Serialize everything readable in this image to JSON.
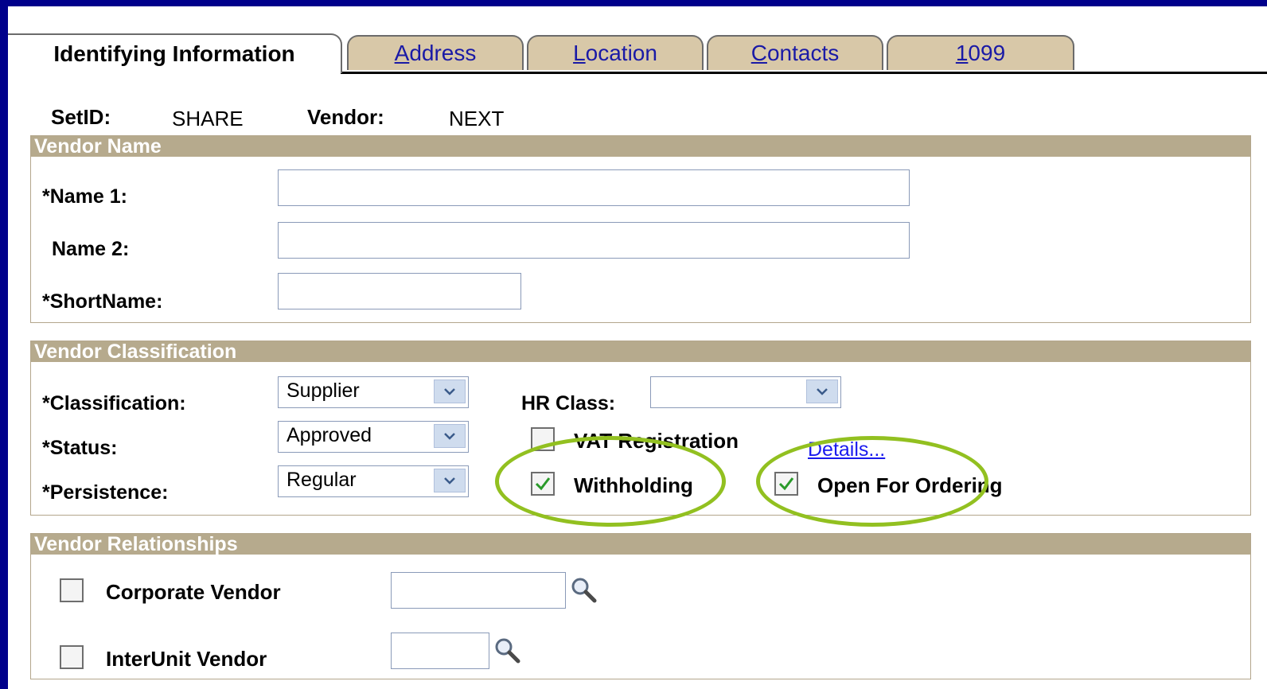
{
  "tabs": [
    {
      "label": "Identifying Information",
      "active": true
    },
    {
      "label": "Address",
      "active": false,
      "underline_char": "A"
    },
    {
      "label": "Location",
      "active": false,
      "underline_char": "L"
    },
    {
      "label": "Contacts",
      "active": false,
      "underline_char": "C"
    },
    {
      "label": "1099",
      "active": false,
      "underline_char": "1"
    }
  ],
  "header": {
    "setid_label": "SetID:",
    "setid_value": "SHARE",
    "vendor_label": "Vendor:",
    "vendor_value": "NEXT"
  },
  "vendor_name": {
    "title": "Vendor Name",
    "name1_label": "*Name 1:",
    "name1_value": "",
    "name2_label": "Name 2:",
    "name2_value": "",
    "shortname_label": "*ShortName:",
    "shortname_value": ""
  },
  "classification": {
    "title": "Vendor Classification",
    "classification_label": "*Classification:",
    "classification_value": "Supplier",
    "status_label": "*Status:",
    "status_value": "Approved",
    "persistence_label": "*Persistence:",
    "persistence_value": "Regular",
    "hr_class_label": "HR Class:",
    "hr_class_value": "",
    "vat_label": "VAT Registration",
    "vat_checked": false,
    "details_link": "Details...",
    "withholding_label": "Withholding",
    "withholding_checked": true,
    "open_for_ordering_label": "Open For Ordering",
    "open_for_ordering_checked": true
  },
  "relationships": {
    "title": "Vendor Relationships",
    "corporate_label": "Corporate Vendor",
    "corporate_checked": false,
    "corporate_value": "",
    "interunit_label": "InterUnit Vendor",
    "interunit_checked": false,
    "interunit_value": ""
  },
  "colors": {
    "background": "#00008b",
    "section_header": "#b6aa8d",
    "tab_inactive": "#d8c8a8",
    "highlight_ellipse": "#92c020",
    "check_green": "#2a9a2a",
    "link": "#1a1aee"
  },
  "icons": {
    "dropdown": "chevron-down-icon",
    "lookup": "magnifier-icon",
    "check": "check-icon"
  }
}
